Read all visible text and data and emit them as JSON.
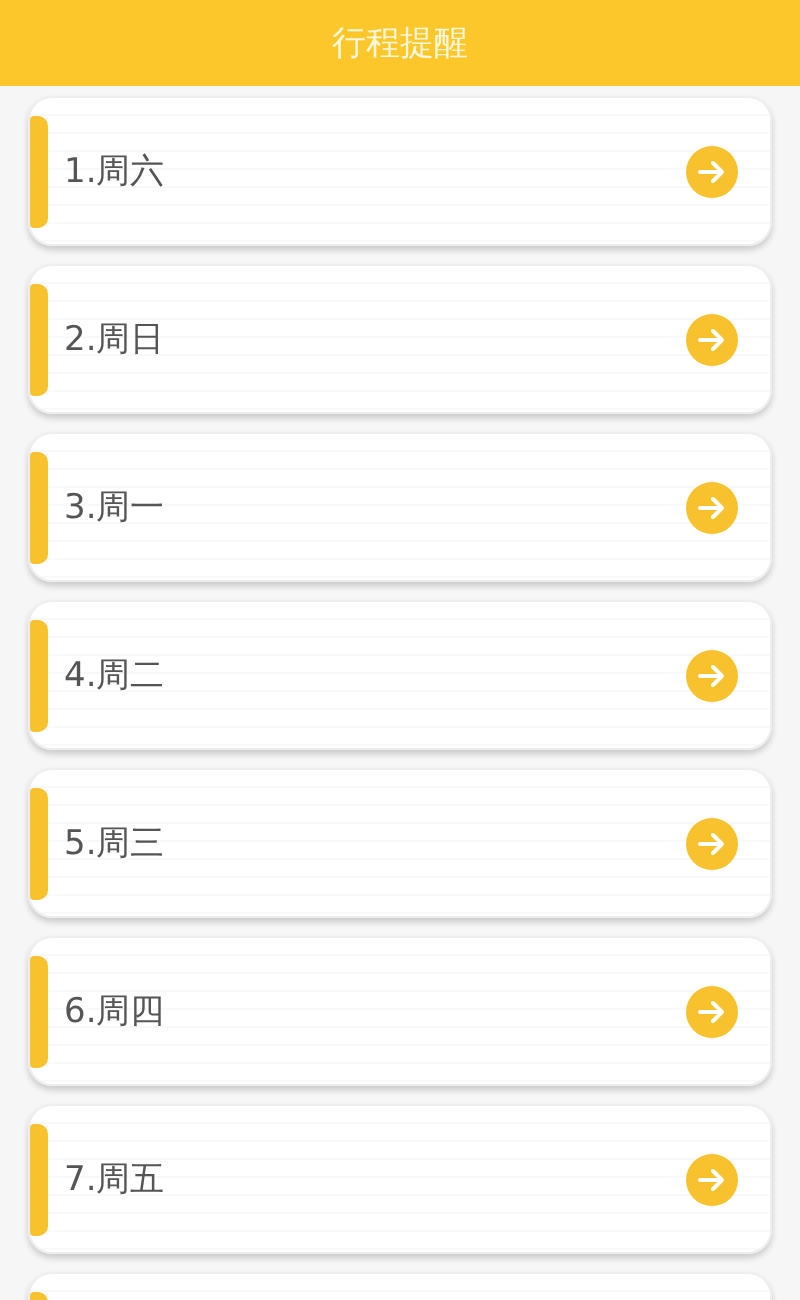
{
  "header": {
    "title": "行程提醒"
  },
  "days": [
    {
      "label": "1.周六"
    },
    {
      "label": "2.周日"
    },
    {
      "label": "3.周一"
    },
    {
      "label": "4.周二"
    },
    {
      "label": "5.周三"
    },
    {
      "label": "6.周四"
    },
    {
      "label": "7.周五"
    }
  ],
  "more_below": true
}
